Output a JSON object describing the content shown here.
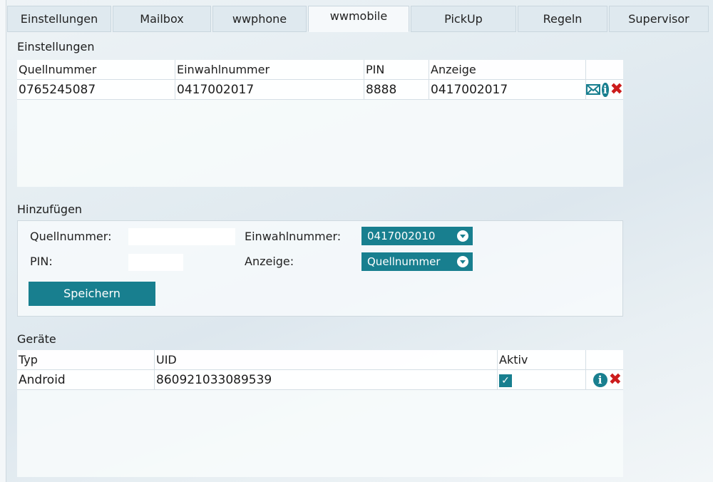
{
  "tabs": [
    {
      "label": "Einstellungen",
      "width": 148
    },
    {
      "label": "Mailbox",
      "width": 140
    },
    {
      "label": "wwphone",
      "width": 134
    },
    {
      "label": "wwmobile",
      "width": 140
    },
    {
      "label": "PickUp",
      "width": 150
    },
    {
      "label": "Regeln",
      "width": 128
    },
    {
      "label": "Supervisor",
      "width": 130
    }
  ],
  "active_tab": "wwmobile",
  "settings": {
    "title": "Einstellungen",
    "columns": [
      "Quellnummer",
      "Einwahlnummer",
      "PIN",
      "Anzeige"
    ],
    "rows": [
      {
        "quellnummer": "0765245087",
        "einwahlnummer": "0417002017",
        "pin": "8888",
        "anzeige": "0417002017"
      }
    ]
  },
  "add": {
    "title": "Hinzufügen",
    "quellnummer_label": "Quellnummer:",
    "quellnummer_value": "",
    "pin_label": "PIN:",
    "pin_value": "",
    "einwahlnummer_label": "Einwahlnummer:",
    "einwahlnummer_value": "0417002010",
    "anzeige_label": "Anzeige:",
    "anzeige_value": "Quellnummer",
    "save_label": "Speichern"
  },
  "devices": {
    "title": "Geräte",
    "columns": [
      "Typ",
      "UID",
      "Aktiv"
    ],
    "rows": [
      {
        "typ": "Android",
        "uid": "860921033089539",
        "aktiv": true,
        "aktiv_mark": "✓"
      }
    ]
  },
  "colors": {
    "accent": "#187f8f",
    "delete": "#cc1c1c"
  }
}
